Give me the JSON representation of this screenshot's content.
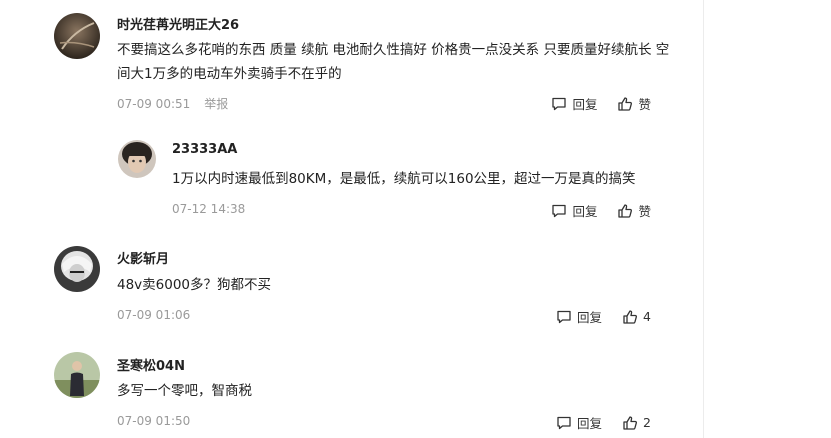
{
  "comments": [
    {
      "user": "时光荏苒光明正大26",
      "text": "不要搞这么多花哨的东西 质量 续航 电池耐久性搞好 价格贵一点没关系 只要质量好续航长 空间大1万多的电动车外卖骑手不在乎的",
      "time": "07-09 00:51",
      "report": "举报",
      "reply_label": "回复",
      "like_label": "赞"
    },
    {
      "user": "23333AA",
      "text": "1万以内时速最低到80KM，是最低，续航可以160公里，超过一万是真的搞笑",
      "time": "07-12 14:38",
      "reply_label": "回复",
      "like_label": "赞"
    },
    {
      "user": "火影斩月",
      "text": "48v卖6000多？狗都不买",
      "time": "07-09 01:06",
      "reply_label": "回复",
      "like_label": "4"
    },
    {
      "user": "圣寒松04N",
      "text": "多写一个零吧，智商税",
      "time": "07-09 01:50",
      "reply_label": "回复",
      "like_label": "2"
    }
  ]
}
